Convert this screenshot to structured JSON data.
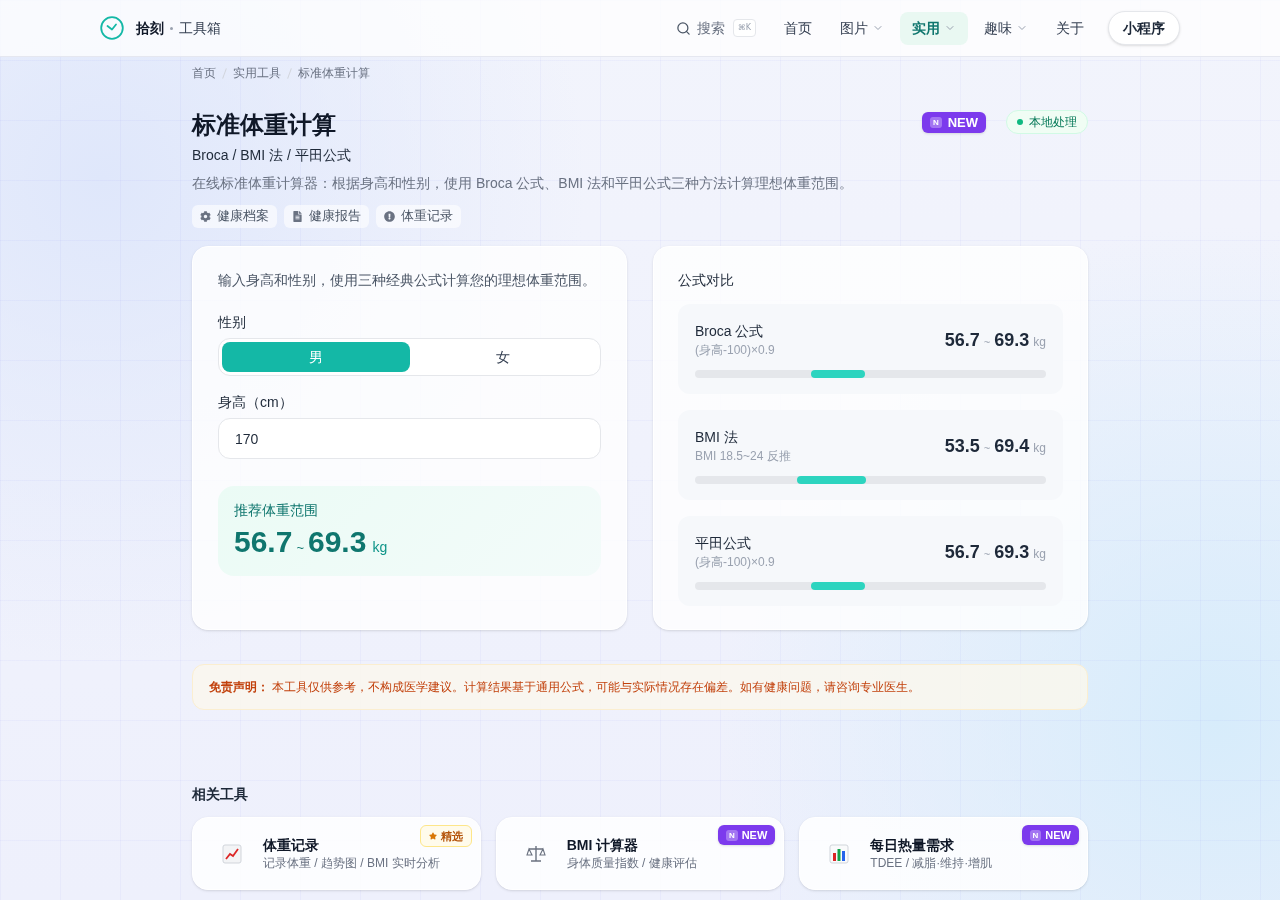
{
  "header": {
    "brand": "拾刻",
    "brand_sub": "工具箱",
    "search": {
      "label": "搜索",
      "shortcut": "⌘K"
    },
    "nav": [
      {
        "label": "首页",
        "dropdown": false,
        "selected": false
      },
      {
        "label": "图片",
        "dropdown": true,
        "selected": false
      },
      {
        "label": "实用",
        "dropdown": true,
        "selected": true
      },
      {
        "label": "趣味",
        "dropdown": true,
        "selected": false
      },
      {
        "label": "关于",
        "dropdown": false,
        "selected": false
      }
    ],
    "cta": "小程序"
  },
  "breadcrumb": [
    "首页",
    "实用工具",
    "标准体重计算"
  ],
  "page": {
    "title": "标准体重计算",
    "subtitle": "Broca / BMI 法 / 平田公式",
    "description": "在线标准体重计算器：根据身高和性别，使用 Broca 公式、BMI 法和平田公式三种方法计算理想体重范围。",
    "badges": [
      {
        "kind": "new",
        "marker": "N",
        "label": "NEW"
      },
      {
        "kind": "local",
        "label": "本地处理",
        "color": "#10b981"
      }
    ],
    "links": [
      "健康档案",
      "健康报告",
      "体重记录"
    ]
  },
  "calculator": {
    "intro": "输入身高和性别，使用三种经典公式计算您的理想体重范围。",
    "gender": {
      "label": "性别",
      "options": [
        {
          "label": "男",
          "selected": true
        },
        {
          "label": "女",
          "selected": false
        }
      ]
    },
    "height": {
      "label": "身高（cm）",
      "value": "170"
    },
    "result": {
      "label": "推荐体重范围",
      "low": "56.7",
      "separator": "~",
      "high": "69.3",
      "unit": "kg"
    }
  },
  "comparison": {
    "title": "公式对比",
    "rows": [
      {
        "name": "Broca 公式",
        "formula": "(身高-100)×0.9",
        "low": "56.7",
        "separator": "~",
        "high": "69.3",
        "unit": "kg"
      },
      {
        "name": "BMI 法",
        "formula": "BMI 18.5~24 反推",
        "low": "53.5",
        "separator": "~",
        "high": "69.4",
        "unit": "kg"
      },
      {
        "name": "平田公式",
        "formula": "(身高-100)×0.9",
        "low": "56.7",
        "separator": "~",
        "high": "69.3",
        "unit": "kg"
      }
    ]
  },
  "disclaimer": "**免责声明：** 本工具仅供参考，不构成医学建议。计算结果基于通用公式，可能与实际情况存在偏差。如有健康问题，请咨询专业医生。",
  "related": {
    "title": "相关工具",
    "tools": [
      {
        "name": "体重记录",
        "description": "记录体重 / 趋势图 / BMI 实时分析",
        "badge": {
          "kind": "featured",
          "label": "精选"
        }
      },
      {
        "name": "BMI 计算器",
        "description": "身体质量指数 / 健康评估",
        "badge": {
          "kind": "new",
          "marker": "N",
          "label": "NEW"
        }
      },
      {
        "name": "每日热量需求",
        "description": "TDEE / 减脂·维持·增肌",
        "badge": {
          "kind": "new",
          "marker": "N",
          "label": "NEW"
        }
      }
    ]
  }
}
